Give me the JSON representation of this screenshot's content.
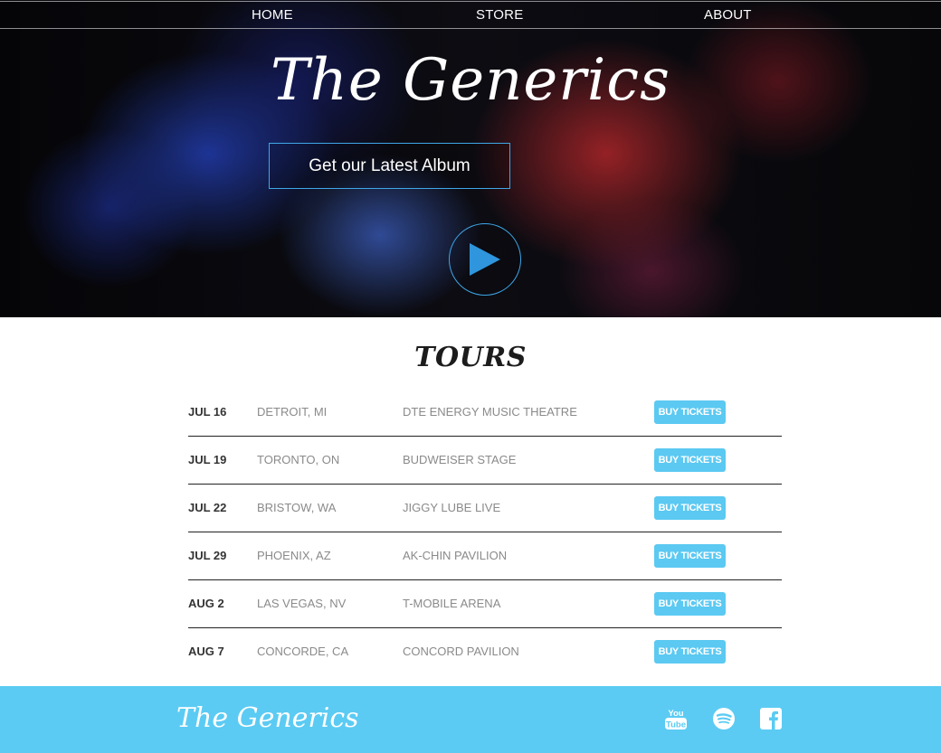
{
  "nav": {
    "home": "HOME",
    "store": "STORE",
    "about": "ABOUT"
  },
  "hero": {
    "title": "The Generics",
    "album_button": "Get our Latest Album",
    "play_icon": "play-icon"
  },
  "tours": {
    "heading": "TOURS",
    "buy_label": "BUY TICKETS",
    "rows": [
      {
        "date": "JUL 16",
        "city": "DETROIT, MI",
        "venue": "DTE ENERGY MUSIC THEATRE"
      },
      {
        "date": "JUL 19",
        "city": "TORONTO, ON",
        "venue": "BUDWEISER STAGE"
      },
      {
        "date": "JUL 22",
        "city": "BRISTOW, WA",
        "venue": "JIGGY LUBE LIVE"
      },
      {
        "date": "JUL 29",
        "city": "PHOENIX, AZ",
        "venue": "AK-CHIN PAVILION"
      },
      {
        "date": "AUG 2",
        "city": "LAS VEGAS, NV",
        "venue": "T-MOBILE ARENA"
      },
      {
        "date": "AUG 7",
        "city": "CONCORDE, CA",
        "venue": "CONCORD PAVILION"
      }
    ]
  },
  "footer": {
    "title": "The Generics",
    "social_icons": [
      "youtube-icon",
      "spotify-icon",
      "facebook-icon"
    ]
  },
  "colors": {
    "accent_blue": "#3fa7e8",
    "ticket_button": "#5bc9f2",
    "footer_bg": "#5bcbf3"
  }
}
